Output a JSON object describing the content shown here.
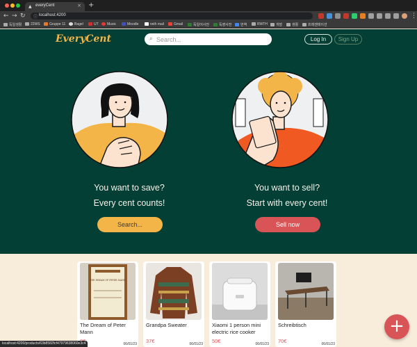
{
  "browser": {
    "tab_title": "everyCent",
    "url": "localhost:4200",
    "status_url": "localhost:4200/products/63b8582fcf47979638060e3c4",
    "bookmarks": [
      "독일생활",
      "22WS",
      "Gruppe 11",
      "Bagel",
      "UT",
      "Music",
      "Moodle",
      "rwth mail",
      "Gmail",
      "독일어사전",
      "독영사전",
      "번역",
      "RWTH",
      "개발",
      "생활",
      "프레젠테이션"
    ]
  },
  "header": {
    "logo": "EveryCent",
    "search_placeholder": "Search...",
    "login_label": "Log In",
    "signup_label": "Sign Up"
  },
  "hero": {
    "left_line1": "You want to save?",
    "left_line2": "Every cent counts!",
    "left_button": "Search...",
    "right_line1": "You want to sell?",
    "right_line2": "Start with every cent!",
    "right_button": "Sell now"
  },
  "products": [
    {
      "title": "The Dream of Peter Mann",
      "price": "8€",
      "date": "06/01/23"
    },
    {
      "title": "Grandpa Sweater",
      "price": "37€",
      "date": "06/01/23"
    },
    {
      "title": "Xiaomi 1 person mini electric rice cooker",
      "price": "50€",
      "date": "06/01/23"
    },
    {
      "title": "Schreibtisch",
      "price": "70€",
      "date": "06/01/23"
    }
  ],
  "book_cover_title": "THE DREAM OF PETER MANN",
  "fab_label": "+",
  "colors": {
    "hero_bg": "#033f34",
    "accent_yellow": "#f4b548",
    "accent_red": "#d95456",
    "page_bg": "#f8ecdb"
  }
}
